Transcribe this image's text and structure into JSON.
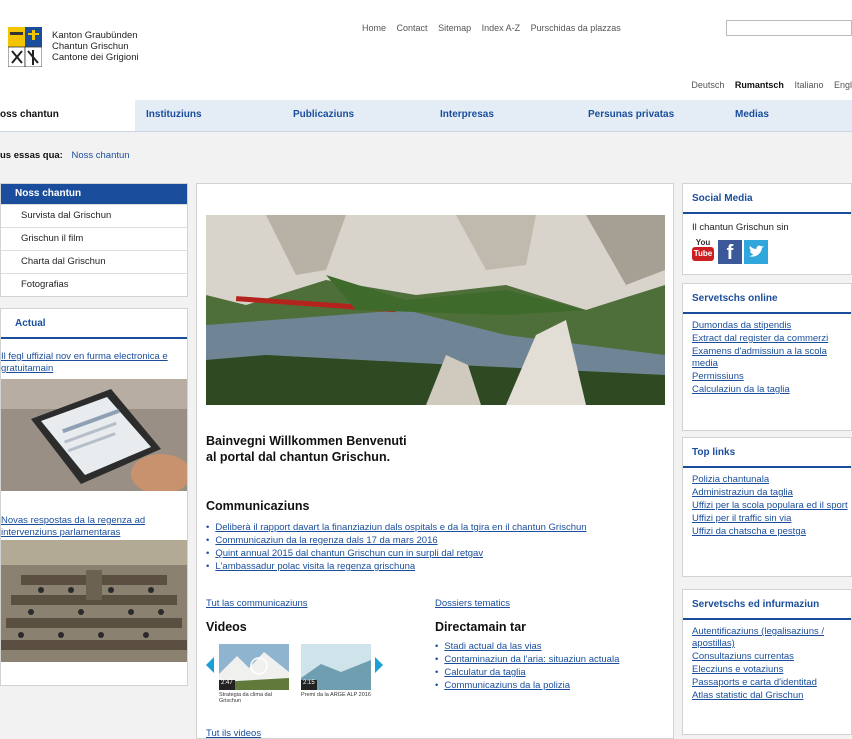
{
  "header": {
    "kanton": [
      "Kanton Graubünden",
      "Chantun Grischun",
      "Cantone dei Grigioni"
    ],
    "topnav": [
      "Home",
      "Contact",
      "Sitemap",
      "Index A-Z",
      "Purschidas da plazzas"
    ],
    "languages": [
      "Deutsch",
      "Rumantsch",
      "Italiano",
      "Engl"
    ],
    "active_language": "Rumantsch"
  },
  "mainnav": [
    "oss chantun",
    "Instituziuns",
    "Publicaziuns",
    "Interpresas",
    "Persunas privatas",
    "Medias"
  ],
  "breadcrumb": {
    "label": "us essas qua:",
    "current": "Noss chantun"
  },
  "leftmenu": {
    "head": "Noss chantun",
    "items": [
      "Survista dal Grischun",
      "Grischun il film",
      "Charta dal Grischun",
      "Fotografias"
    ]
  },
  "actual": {
    "title": "Actual",
    "link1": "Il fegl uffizial nov en furma electronica e gratuitamain",
    "link2": "Novas respostas da la regenza ad intervenziuns parlamentaras"
  },
  "center": {
    "welcome_line1": "Bainvegni Willkommen Benvenuti",
    "welcome_line2": "al portal dal chantun Grischun.",
    "communications_title": "Communicaziuns",
    "news": [
      "Deliberà il rapport davart la finanziaziun dals ospitals e da la tgira en il chantun Grischun",
      "Communicaziun da la regenza dals 17 da mars 2016",
      "Quint annual 2015 dal chantun Grischun cun in surpli dal retgav",
      "L'ambassadur polac visita la regenza grischuna"
    ],
    "all_communications": "Tut las communicaziuns",
    "dossiers": "Dossiers tematics",
    "videos_title": "Videos",
    "video1_time": "2:47",
    "video1_caption": "Strategia da clima dal Grischun",
    "video2_time": "2:15",
    "video2_caption": "Premi da la ARGE ALP 2016",
    "all_videos": "Tut ils videos",
    "direct_title": "Directamain tar",
    "direct": [
      "Stadi actual da las vias",
      "Contaminaziun da l'aria: situaziun actuala",
      "Calculatur da taglia",
      "Communicaziuns da la polizia"
    ]
  },
  "right": {
    "social_title": "Social Media",
    "social_text": "Il chantun Grischun sin",
    "youtube_top": "You",
    "youtube_bottom": "Tube",
    "servetschs_title": "Servetschs online",
    "servetschs": [
      "Dumondas da stipendis",
      "Extract dal register da commerzi",
      "Examens d'admissiun a la scola media",
      "Permissiuns",
      "Calculaziun da la taglia"
    ],
    "toplinks_title": "Top links",
    "toplinks": [
      "Polizia chantunala",
      "Administraziun da taglia",
      "Uffizi per la scola populara ed il sport",
      "Uffizi per il traffic sin via",
      "Uffizi da chatscha e pestga"
    ],
    "info_title": "Servetschs ed infurmaziun",
    "info": [
      "Autentificaziuns (legalisaziuns / apostillas)",
      "Consultaziuns currentas",
      "Elecziuns e votaziuns",
      "Passaports e carta d'identitad",
      "Atlas statistic dal Grischun"
    ]
  },
  "colors": {
    "brand_blue": "#1a4e9c",
    "nav_bg": "#e4ecf5",
    "youtube_red": "#cc1f1f",
    "facebook_blue": "#3b5998",
    "twitter_blue": "#2fa6dc"
  }
}
